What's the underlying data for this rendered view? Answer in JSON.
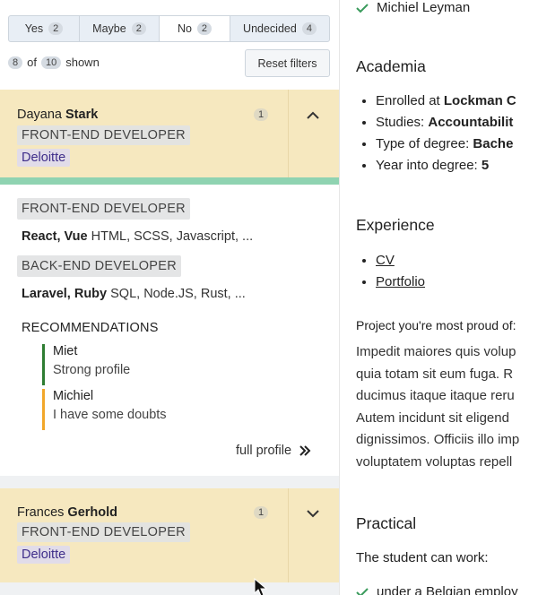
{
  "filters": [
    {
      "label": "Yes",
      "count": "2"
    },
    {
      "label": "Maybe",
      "count": "2"
    },
    {
      "label": "No",
      "count": "2"
    },
    {
      "label": "Undecided",
      "count": "4"
    }
  ],
  "shown": {
    "visible": "8",
    "of": "of",
    "total": "10",
    "suffix": "shown"
  },
  "reset_label": "Reset filters",
  "cards": [
    {
      "first_name": "Dayana",
      "last_name": "Stark",
      "count": "1",
      "role": "FRONT-END DEVELOPER",
      "company": "Deloitte",
      "expanded": true
    },
    {
      "first_name": "Frances",
      "last_name": "Gerhold",
      "count": "1",
      "role": "FRONT-END DEVELOPER",
      "company": "Deloitte",
      "expanded": false
    }
  ],
  "details": {
    "skills": [
      {
        "tag": "FRONT-END DEVELOPER",
        "bold": "React, Vue",
        "rest": "HTML, SCSS, Javascript, ..."
      },
      {
        "tag": "BACK-END DEVELOPER",
        "bold": "Laravel, Ruby",
        "rest": "SQL, Node.JS, Rust, ..."
      }
    ],
    "recommendations_title": "RECOMMENDATIONS",
    "recommendations": [
      {
        "name": "Miet",
        "text": "Strong profile",
        "color": "#2e7d32"
      },
      {
        "name": "Michiel",
        "text": "I have some doubts",
        "color": "#f2a72a"
      }
    ],
    "full_profile": "full profile"
  },
  "right": {
    "top_name": "Michiel Leyman",
    "academia_title": "Academia",
    "academia": [
      {
        "label": "Enrolled at ",
        "value": "Lockman C"
      },
      {
        "label": "Studies: ",
        "value": "Accountabilit"
      },
      {
        "label": "Type of degree: ",
        "value": "Bache"
      },
      {
        "label": "Year into degree: ",
        "value": "5"
      }
    ],
    "experience_title": "Experience",
    "experience_links": [
      "CV",
      "Portfolio"
    ],
    "project_question": "Project you're most proud of:",
    "project_lines": [
      "Impedit maiores quis volup",
      "quia totam sit eum fuga. R",
      "ducimus itaque itaque reru",
      "Autem incidunt sit eligend",
      "dignissimos. Officiis illo imp",
      "voluptatem voluptas repell"
    ],
    "practical_title": "Practical",
    "can_work": "The student can work:",
    "can_work_first": "under a Belgian employ"
  },
  "colors": {
    "card_bg": "#f6e8bf",
    "company_text": "#3f2e8a",
    "positive_green": "#2e7d32",
    "doubt_orange": "#f2a72a",
    "status_bar": "#8fd3b1"
  }
}
